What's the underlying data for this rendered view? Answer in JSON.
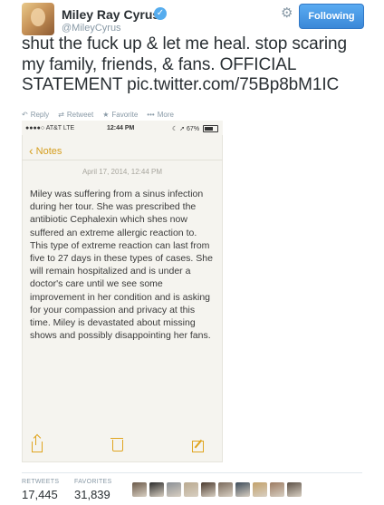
{
  "user": {
    "name": "Miley Ray Cyrus",
    "handle": "@MileyCyrus",
    "verified_mark": "✓"
  },
  "follow_button": {
    "label": "Following"
  },
  "tweet": {
    "text": "shut the fuck up & let me heal. stop scaring my family, friends, & fans. OFFICIAL STATEMENT pic.twitter.com/75Bp8bM1IC"
  },
  "actions": [
    {
      "icon": "reply-icon",
      "glyph": "↶",
      "label": "Reply"
    },
    {
      "icon": "retweet-icon",
      "glyph": "⇄",
      "label": "Retweet"
    },
    {
      "icon": "star-icon",
      "glyph": "★",
      "label": "Favorite"
    },
    {
      "icon": "more-icon",
      "glyph": "•••",
      "label": "More"
    }
  ],
  "phone": {
    "carrier": "●●●●○ AT&T  LTE",
    "time": "12:44 PM",
    "battery": "☾ ➚ 67%",
    "back_label": "Notes",
    "note_date": "April 17, 2014, 12:44 PM",
    "note_body": "Miley was suffering from a sinus infection during her tour. She was prescribed the antibiotic Cephalexin which shes now suffered an extreme allergic reaction to. This type of extreme reaction can last from five to 27 days in these types of cases. She will remain hospitalized and is under a doctor's care until we see some improvement in her condition and is asking for your compassion and privacy at this time. Miley is devastated about missing shows and possibly disappointing her fans.",
    "accent_color": "#e0a520"
  },
  "stats": {
    "retweets_label": "RETWEETS",
    "retweets_value": "17,445",
    "favorites_label": "FAVORITES",
    "favorites_value": "31,839"
  },
  "favoriter_avatars": 10
}
